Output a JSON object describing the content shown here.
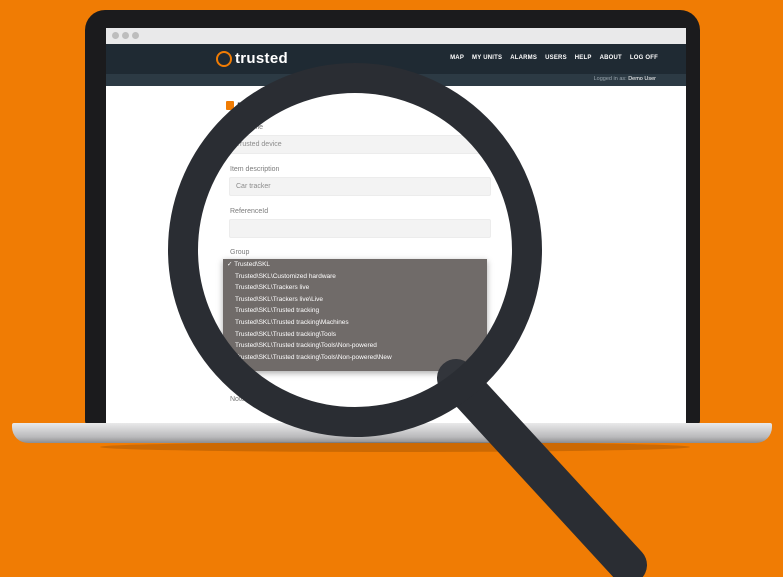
{
  "colors": {
    "background": "#f07c04",
    "header": "#1f2a33",
    "dropdown": "#6b6563",
    "handle": "#2a2d33"
  },
  "app": {
    "logo_text": "trusted"
  },
  "nav": {
    "items": [
      "MAP",
      "MY UNITS",
      "ALARMS",
      "USERS",
      "HELP",
      "ABOUT",
      "LOG OFF"
    ]
  },
  "login": {
    "prefix": "Logged in as:",
    "user": "Demo User"
  },
  "page": {
    "title": "Device"
  },
  "form": {
    "unit_name": {
      "label": "Unit Name",
      "value": "Trusted device"
    },
    "description": {
      "label": "Item description",
      "value": "Car tracker"
    },
    "reference": {
      "label": "ReferenceId",
      "value": ""
    },
    "group": {
      "label": "Group"
    },
    "notes": {
      "label": "Notes"
    }
  },
  "dropdown": {
    "selected_mark": "✓",
    "options": [
      "Trusted\\SKL",
      "Trusted\\SKL\\Customized hardware",
      "Trusted\\SKL\\Trackers live",
      "Trusted\\SKL\\Trackers live\\Live",
      "Trusted\\SKL\\Trusted tracking",
      "Trusted\\SKL\\Trusted tracking\\Machines",
      "Trusted\\SKL\\Trusted tracking\\Tools",
      "Trusted\\SKL\\Trusted tracking\\Tools\\Non-powered",
      "Trusted\\SKL\\Trusted tracking\\Tools\\Non-powered\\New"
    ]
  },
  "icons": {
    "magnifier": "magnifying-glass-icon",
    "logo": "location-pin-logo-icon"
  }
}
